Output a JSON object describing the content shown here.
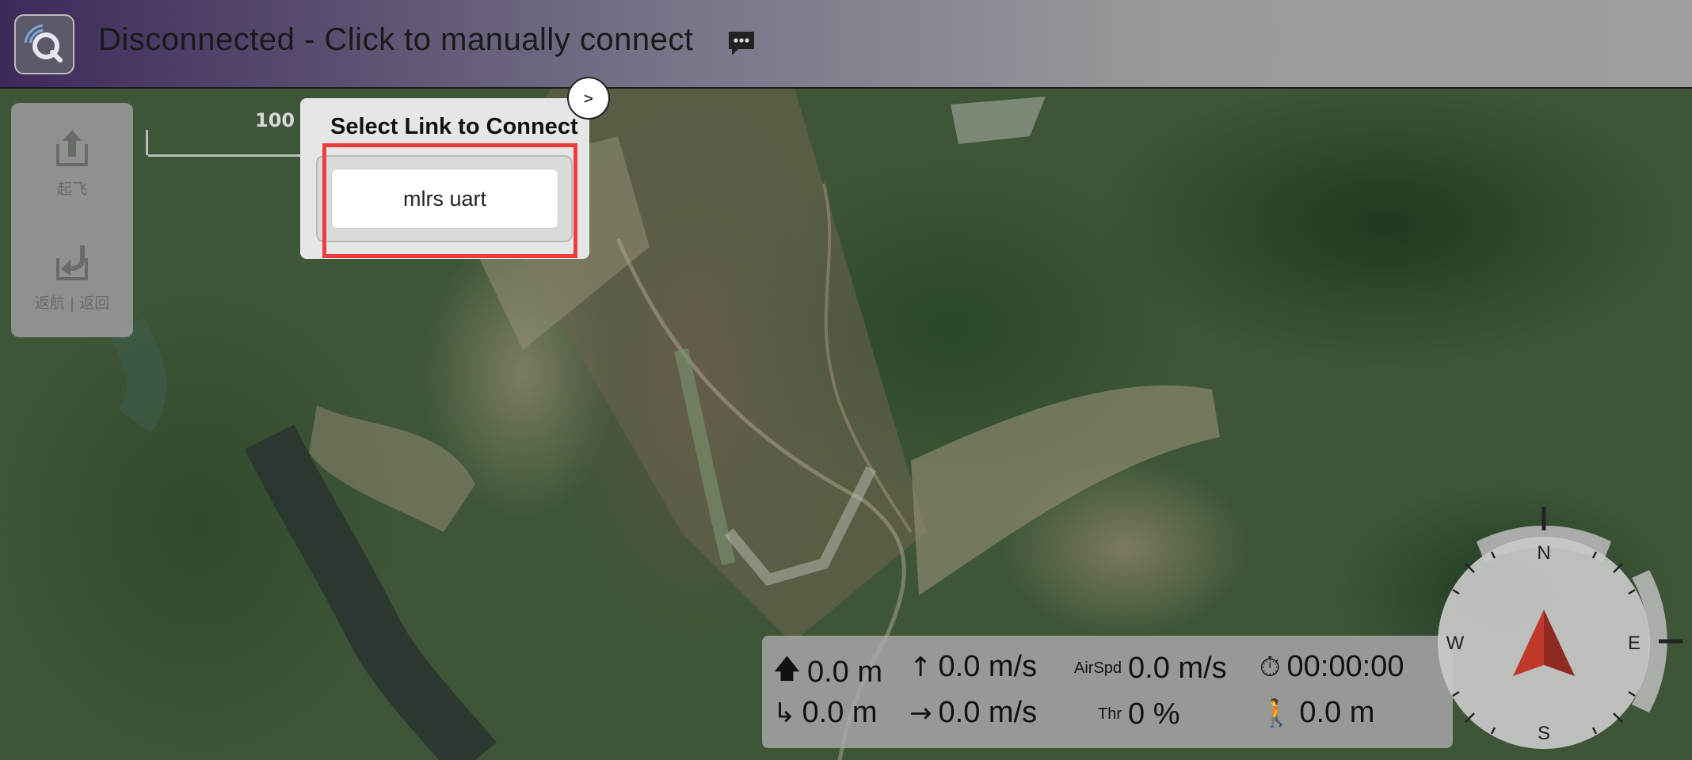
{
  "topbar": {
    "status": "Disconnected - Click to manually connect",
    "logo_icon": "qgc-logo-icon",
    "message_icon": "chat-bubble-icon"
  },
  "toolstrip": {
    "takeoff_label": "起飞",
    "return_label": "返航 | 返回"
  },
  "map": {
    "scale_label": "100 米"
  },
  "popup": {
    "title": "Select Link to Connect",
    "links": [
      "mlrs uart"
    ],
    "collapse_label": ">"
  },
  "telemetry": {
    "altitude": "0.0 m",
    "vertical_speed": "0.0 m/s",
    "airspeed_label": "AirSpd",
    "airspeed": "0.0 m/s",
    "flight_time": "00:00:00",
    "distance_home": "0.0 m",
    "horizontal_speed": "0.0 m/s",
    "throttle_label": "Thr",
    "throttle": "0 %",
    "distance_walked": "0.0 m"
  },
  "compass": {
    "n": "N",
    "e": "E",
    "s": "S",
    "w": "W"
  },
  "colors": {
    "highlight": "#ee3b3b",
    "heading_arrow": "#a7342b"
  }
}
